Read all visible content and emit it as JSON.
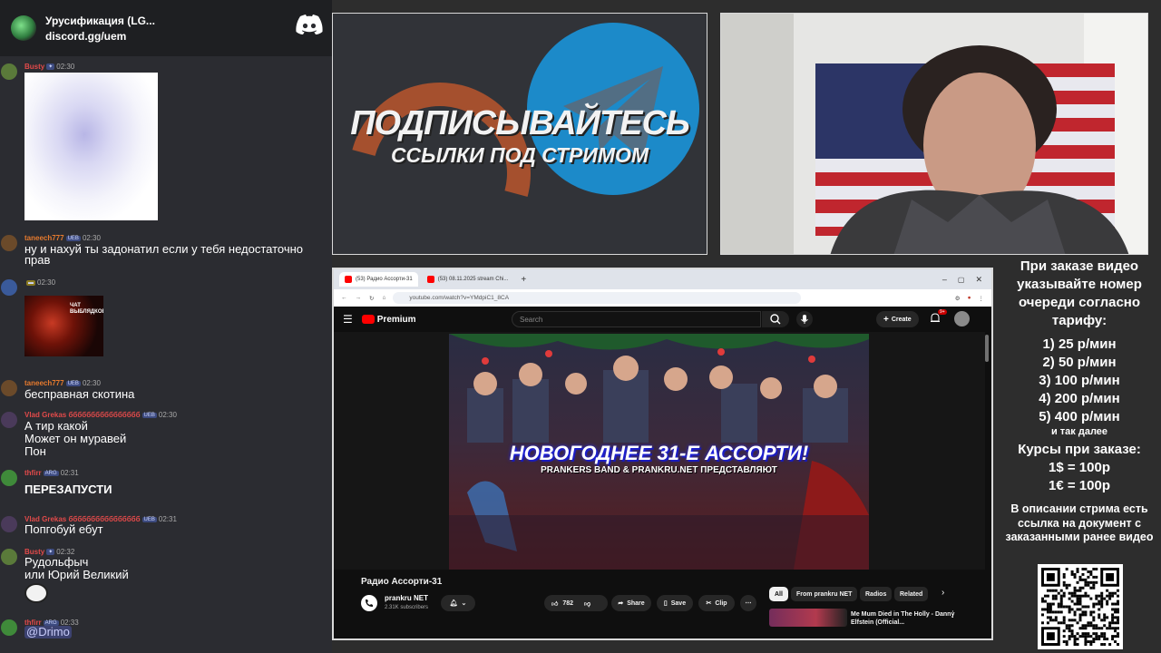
{
  "chat": {
    "server_name": "Урусификация (LG...",
    "server_link": "discord.gg/uem",
    "messages": [
      {
        "user": "Busty",
        "time": "02:30",
        "lines": [],
        "has_image": true,
        "user_color": "#e24a4a"
      },
      {
        "user": "taneech777",
        "badge": "UEB",
        "time": "02:30",
        "lines": [
          "ну и нахуй ты задонатил если у тебя недостаточно",
          "прав"
        ],
        "user_color": "#e67a2e"
      },
      {
        "user": "",
        "time": "02:30",
        "lines": [],
        "image_text": "ЧАТ ВЫБЛЯДКОВ",
        "user_color": "#e8c34a"
      },
      {
        "user": "taneech777",
        "badge": "UEB",
        "time": "02:30",
        "lines": [
          "бесправная скотина"
        ],
        "user_color": "#e67a2e"
      },
      {
        "user": "Vlad Grekas бббббббббббббббб",
        "badge": "UEB",
        "time": "02:30",
        "lines": [
          "А тир какой",
          "Может он муравей",
          "Пон"
        ],
        "user_color": "#e24a4a"
      },
      {
        "user": "thfirr",
        "badge": "ARG",
        "time": "02:31",
        "lines": [
          "ПЕРЕЗАПУСТИ"
        ],
        "bold": true,
        "user_color": "#e24a4a"
      },
      {
        "user": "Vlad Grekas бббббббббббббббб",
        "badge": "UEB",
        "time": "02:31",
        "lines": [
          "Попгобуй ебут"
        ],
        "user_color": "#e24a4a"
      },
      {
        "user": "Busty",
        "time": "02:32",
        "lines": [
          "Рудольфыч",
          "или Юрий Великий"
        ],
        "has_emoji": true,
        "user_color": "#e24a4a"
      },
      {
        "user": "thfirr",
        "badge": "ARG",
        "time": "02:33",
        "lines": [
          "@Drimo"
        ],
        "mention": true,
        "user_color": "#e24a4a"
      }
    ]
  },
  "banner": {
    "title": "ПОДПИСЫВАЙТЕСЬ",
    "subtitle": "ССЫЛКИ ПОД СТРИМОМ"
  },
  "browser": {
    "tabs": [
      {
        "label": "(53) Радио Ассорти-31",
        "active": true
      },
      {
        "label": "(53) 08.11.2025 stream Chi...",
        "active": false
      }
    ],
    "url": "youtube.com/watch?v=YMdpiC1_8CA"
  },
  "youtube": {
    "logo_label": "Premium",
    "search_placeholder": "Search",
    "create_label": "Create",
    "notifications": "9+",
    "thumbnail_title": "НОВОГОДНЕЕ 31-Е АССОРТИ!",
    "thumbnail_subtitle": "PRANKERS BAND & PRANKRU.NET ПРЕДСТАВЛЯЮТ",
    "video_title": "Радио Ассорти-31",
    "channel_name": "prankru NET",
    "channel_subs": "2.31K subscribers",
    "likes": "782",
    "share_label": "Share",
    "save_label": "Save",
    "clip_label": "Clip",
    "chips": [
      "All",
      "From prankru NET",
      "Radios",
      "Related"
    ],
    "rec_title": "Me Mum Died in The Holly - Danny Elfstein (Official..."
  },
  "info": {
    "intro": "При заказе видео указывайте номер очереди согласно тарифу:",
    "prices": [
      "1) 25 р/мин",
      "2) 50 р/мин",
      "3) 100 р/мин",
      "4) 200 р/мин",
      "5) 400 р/мин"
    ],
    "more": "и так далее",
    "rates_title": "Курсы при заказе:",
    "rates": [
      "1$ = 100р",
      "1€ = 100р"
    ],
    "doc_note": "В описании стрима есть ссылка на документ с заказанными ранее видео"
  },
  "colors": {
    "discord_bg": "#2b2c31",
    "youtube_red": "#ff0000",
    "mention_bg": "#3c4270"
  }
}
